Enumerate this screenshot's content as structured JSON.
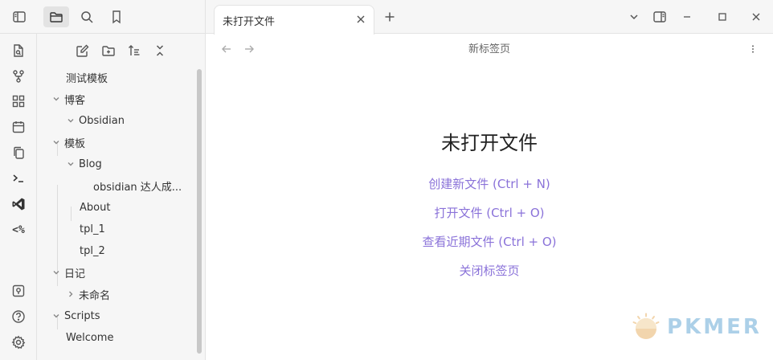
{
  "tab": {
    "title": "未打开文件"
  },
  "view": {
    "title": "新标签页"
  },
  "empty_state": {
    "title": "未打开文件",
    "actions": [
      "创建新文件 (Ctrl + N)",
      "打开文件 (Ctrl + O)",
      "查看近期文件 (Ctrl + O)",
      "关闭标签页"
    ]
  },
  "ribbon": {
    "code_label": "<%"
  },
  "tree": {
    "items": [
      "测试模板",
      "博客",
      "Obsidian",
      "模板",
      "Blog",
      "obsidian 达人成...",
      "About",
      "tpl_1",
      "tpl_2",
      "日记",
      "未命名",
      "Scripts",
      "Welcome"
    ]
  },
  "watermark": {
    "text": "PKMER"
  },
  "colors": {
    "accent": "#8a72d9",
    "sidebar_bg": "#f6f6f6",
    "watermark": "#6aaad6"
  }
}
